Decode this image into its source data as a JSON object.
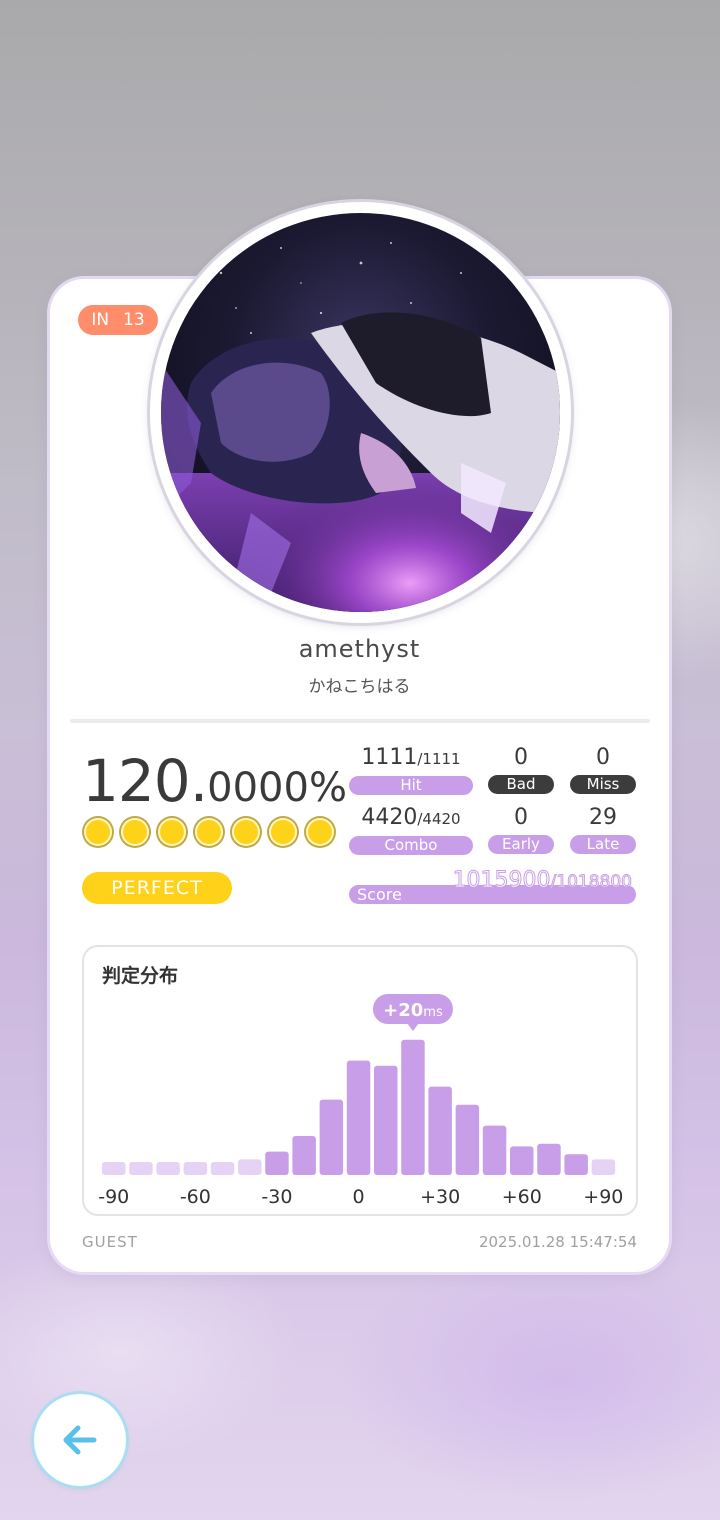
{
  "song": {
    "difficulty": "IN",
    "level": "13",
    "title": "amethyst",
    "artist": "かねこちはる"
  },
  "result": {
    "accuracy_int": "120.",
    "accuracy_dec": "0000%",
    "medal_count": 7,
    "grade": "PERFECT"
  },
  "stats": {
    "hit": {
      "value": "1111",
      "total": "/1111",
      "label": "Hit"
    },
    "bad": {
      "value": "0",
      "label": "Bad"
    },
    "miss": {
      "value": "0",
      "label": "Miss"
    },
    "combo": {
      "value": "4420",
      "total": "/4420",
      "label": "Combo"
    },
    "early": {
      "value": "0",
      "label": "Early"
    },
    "late": {
      "value": "29",
      "label": "Late"
    }
  },
  "score": {
    "label": "Score",
    "value": "1015900",
    "max": "/1018800"
  },
  "footer": {
    "player": "GUEST",
    "datetime": "2025.01.28 15:47:54"
  },
  "colors": {
    "accent_purple": "#c99ee8",
    "bar_light": "#e6d2f4",
    "level_badge": "#ff8c6a",
    "perfect_yellow": "#ffd21a",
    "back_ring": "#a9def2"
  },
  "icons": {
    "back": "left-arrow-icon"
  },
  "chart_data": {
    "type": "bar",
    "title": "判定分布",
    "tick_labels": [
      "-90",
      "-60",
      "-30",
      "0",
      "+30",
      "+60",
      "+90"
    ],
    "x_range": [
      -90,
      90
    ],
    "bin_width": 10,
    "values": [
      5,
      5,
      5,
      5,
      5,
      6,
      9,
      15,
      29,
      44,
      42,
      52,
      34,
      27,
      19,
      11,
      12,
      8,
      6
    ],
    "peak": {
      "value": "+20",
      "unit": "ms",
      "bin_index": 11
    }
  }
}
